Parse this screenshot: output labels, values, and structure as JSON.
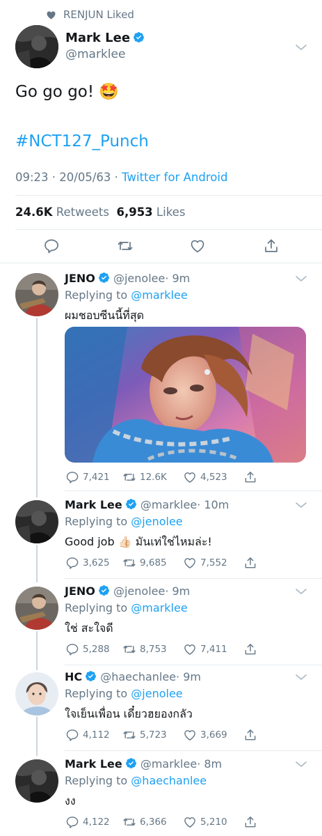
{
  "social_context": {
    "text": "RENJUN Liked"
  },
  "main_tweet": {
    "name": "Mark Lee",
    "handle": "@marklee",
    "text": "Go go go! 🤩",
    "hashtag": "#NCT127_Punch",
    "time": "09:23 · 20/05/63 ·",
    "source": "Twitter for Android",
    "retweets_count": "24.6K",
    "retweets_label": "Retweets",
    "likes_count": "6,953",
    "likes_label": "Likes"
  },
  "replies": [
    {
      "name": "JENO",
      "handle": "@jenolee",
      "time": "· 9m",
      "replying_prefix": "Replying to",
      "replying_to": "@marklee",
      "text": "ผมชอบซีนนี้ที่สุด",
      "has_media": true,
      "replies": "7,421",
      "retweets": "12.6K",
      "likes": "4,523"
    },
    {
      "name": "Mark Lee",
      "handle": "@marklee",
      "time": "· 10m",
      "replying_prefix": "Replying to",
      "replying_to": "@jenolee",
      "text": "Good job 👍🏻 มันเท่ใช่ไหมล่ะ!",
      "replies": "3,625",
      "retweets": "9,685",
      "likes": "7,552"
    },
    {
      "name": "JENO",
      "handle": "@jenolee",
      "time": "· 9m",
      "replying_prefix": "Replying to",
      "replying_to": "@marklee",
      "text": "ใช่ สะใจดี",
      "replies": "5,288",
      "retweets": "8,753",
      "likes": "7,411"
    },
    {
      "name": "HC",
      "handle": "@haechanlee",
      "time": "· 9m",
      "replying_prefix": "Replying to",
      "replying_to": "@jenolee",
      "text": "ใจเย็นเพื่อน เดี๋ยวฮยองกลัว",
      "replies": "4,112",
      "retweets": "5,723",
      "likes": "3,669"
    },
    {
      "name": "Mark Lee",
      "handle": "@marklee",
      "time": "· 8m",
      "replying_prefix": "Replying to",
      "replying_to": "@haechanlee",
      "text": "งง",
      "replies": "4,122",
      "retweets": "6,366",
      "likes": "5,210"
    }
  ],
  "colors": {
    "accent": "#1da1f2",
    "muted": "#657786",
    "text": "#14171a",
    "divider": "#e6ecf0"
  },
  "icons": [
    "heart-icon",
    "verified-icon",
    "chevron-down-icon",
    "reply-icon",
    "retweet-icon",
    "like-icon",
    "share-icon"
  ]
}
